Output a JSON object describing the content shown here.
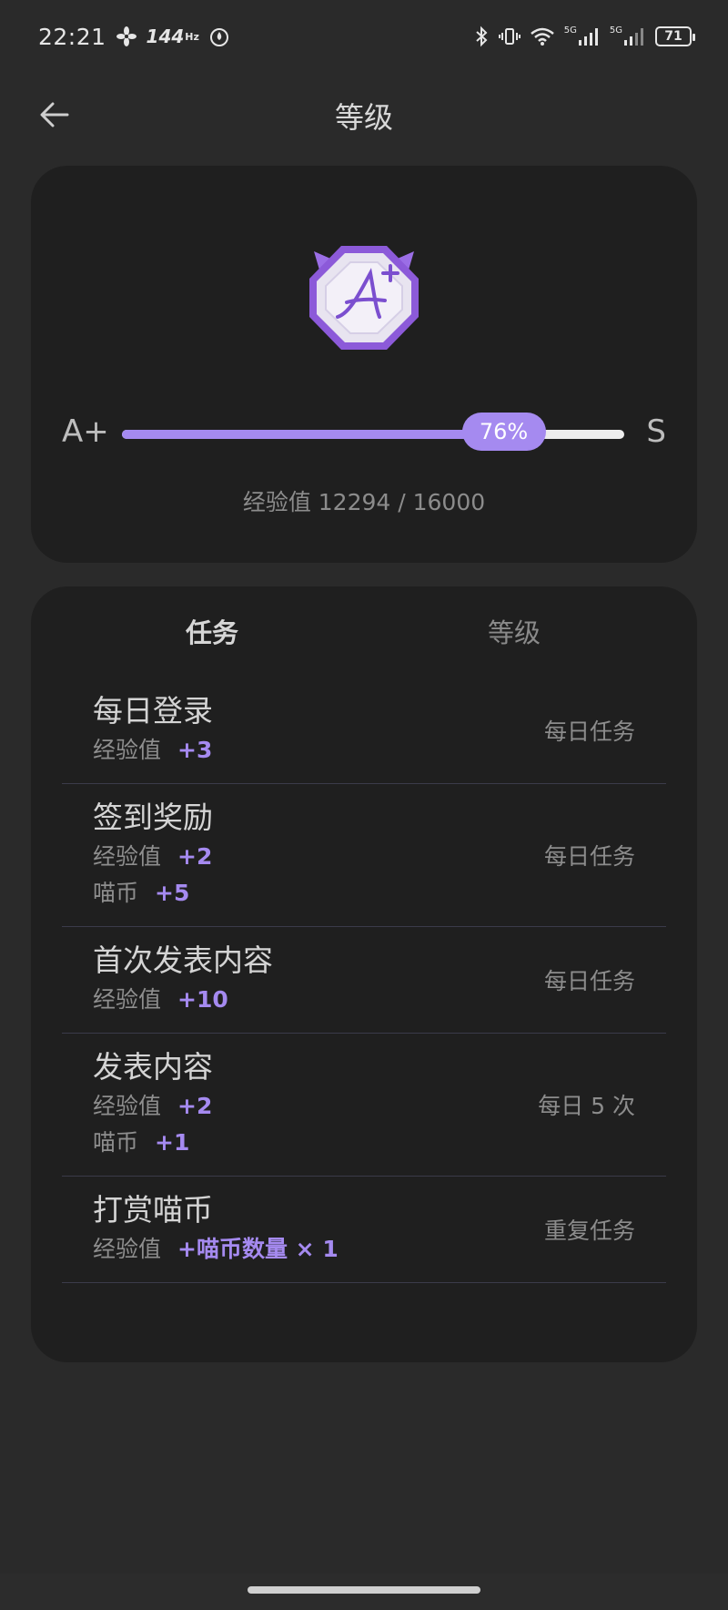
{
  "status_bar": {
    "time": "22:21",
    "refresh_rate": "144",
    "refresh_unit": "Hz",
    "battery": "71",
    "network_a": "5G",
    "network_b": "5G"
  },
  "header": {
    "title": "等级"
  },
  "level_card": {
    "current_level": "A+",
    "next_level": "S",
    "progress_percent": 76,
    "progress_label": "76%",
    "exp_text": "经验值 12294 / 16000"
  },
  "tabs": [
    {
      "label": "任务",
      "active": true
    },
    {
      "label": "等级",
      "active": false
    }
  ],
  "tasks": [
    {
      "name": "每日登录",
      "rewards": [
        {
          "label": "经验值",
          "value": "+3"
        }
      ],
      "frequency": "每日任务"
    },
    {
      "name": "签到奖励",
      "rewards": [
        {
          "label": "经验值",
          "value": "+2"
        },
        {
          "label": "喵币",
          "value": "+5"
        }
      ],
      "frequency": "每日任务"
    },
    {
      "name": "首次发表内容",
      "rewards": [
        {
          "label": "经验值",
          "value": "+10"
        }
      ],
      "frequency": "每日任务"
    },
    {
      "name": "发表内容",
      "rewards": [
        {
          "label": "经验值",
          "value": "+2"
        },
        {
          "label": "喵币",
          "value": "+1"
        }
      ],
      "frequency": "每日 5 次"
    },
    {
      "name": "打赏喵币",
      "rewards": [
        {
          "label": "经验值",
          "value": "+喵币数量 × 1"
        }
      ],
      "frequency": "重复任务"
    }
  ],
  "colors": {
    "accent": "#a58af0",
    "background": "#2a2a2a",
    "card": "#1f1f1f"
  }
}
